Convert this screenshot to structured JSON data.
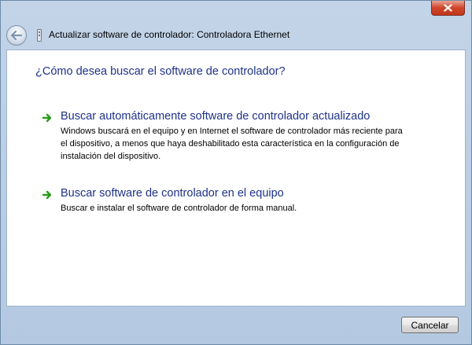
{
  "window": {
    "title": "Actualizar software de controlador: Controladora Ethernet",
    "close_label": "x"
  },
  "content": {
    "heading": "¿Cómo desea buscar el software de controlador?",
    "options": [
      {
        "title": "Buscar automáticamente software de controlador actualizado",
        "description": "Windows buscará en el equipo y en Internet el software de controlador más reciente para el dispositivo, a menos que haya deshabilitado esta característica en la configuración de instalación del dispositivo."
      },
      {
        "title": "Buscar software de controlador en el equipo",
        "description": "Buscar e instalar el software de controlador de forma manual."
      }
    ]
  },
  "footer": {
    "cancel_label": "Cancelar"
  },
  "icons": {
    "back": "back-arrow-icon",
    "device": "device-icon",
    "option_arrow": "green-arrow-icon",
    "close": "close-icon"
  },
  "colors": {
    "accent_text": "#1e3287",
    "arrow_green": "#2a9a1e",
    "close_red": "#c2371c",
    "frame": "#b9cde4"
  }
}
